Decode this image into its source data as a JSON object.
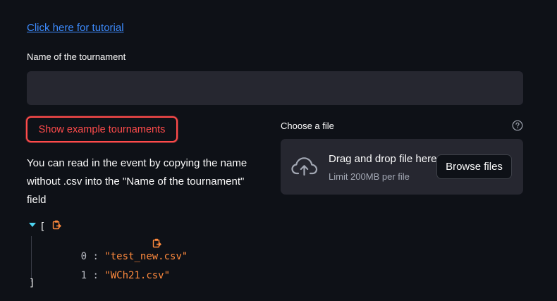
{
  "tutorial": {
    "link_text": "Click here for tutorial"
  },
  "tournament_field": {
    "label": "Name of the tournament",
    "value": "",
    "placeholder": ""
  },
  "example_button": {
    "label": "Show example tournaments"
  },
  "info_text": "You can read in the event by copying the name without .csv into the \"Name of the tournament\" field",
  "json_view": {
    "open_bracket": "[",
    "close_bracket": "]",
    "items": [
      {
        "index": "0",
        "colon": " : ",
        "value": "\"test_new.csv\""
      },
      {
        "index": "1",
        "colon": " : ",
        "value": "\"WCh21.csv\""
      }
    ]
  },
  "uploader": {
    "label": "Choose a file",
    "drop_title": "Drag and drop file here",
    "limit_text": "Limit 200MB per file",
    "browse_label": "Browse files"
  },
  "icons": {
    "copy": "copy-icon",
    "help": "help-circle-icon",
    "upload": "cloud-upload-icon",
    "expand": "caret-down-icon"
  },
  "colors": {
    "background": "#0e1117",
    "input_background": "#262730",
    "accent": "#ff4b4b",
    "link": "#3d8bfd",
    "json_string": "#ff8a3d",
    "json_toggle": "#4dd4f0"
  }
}
